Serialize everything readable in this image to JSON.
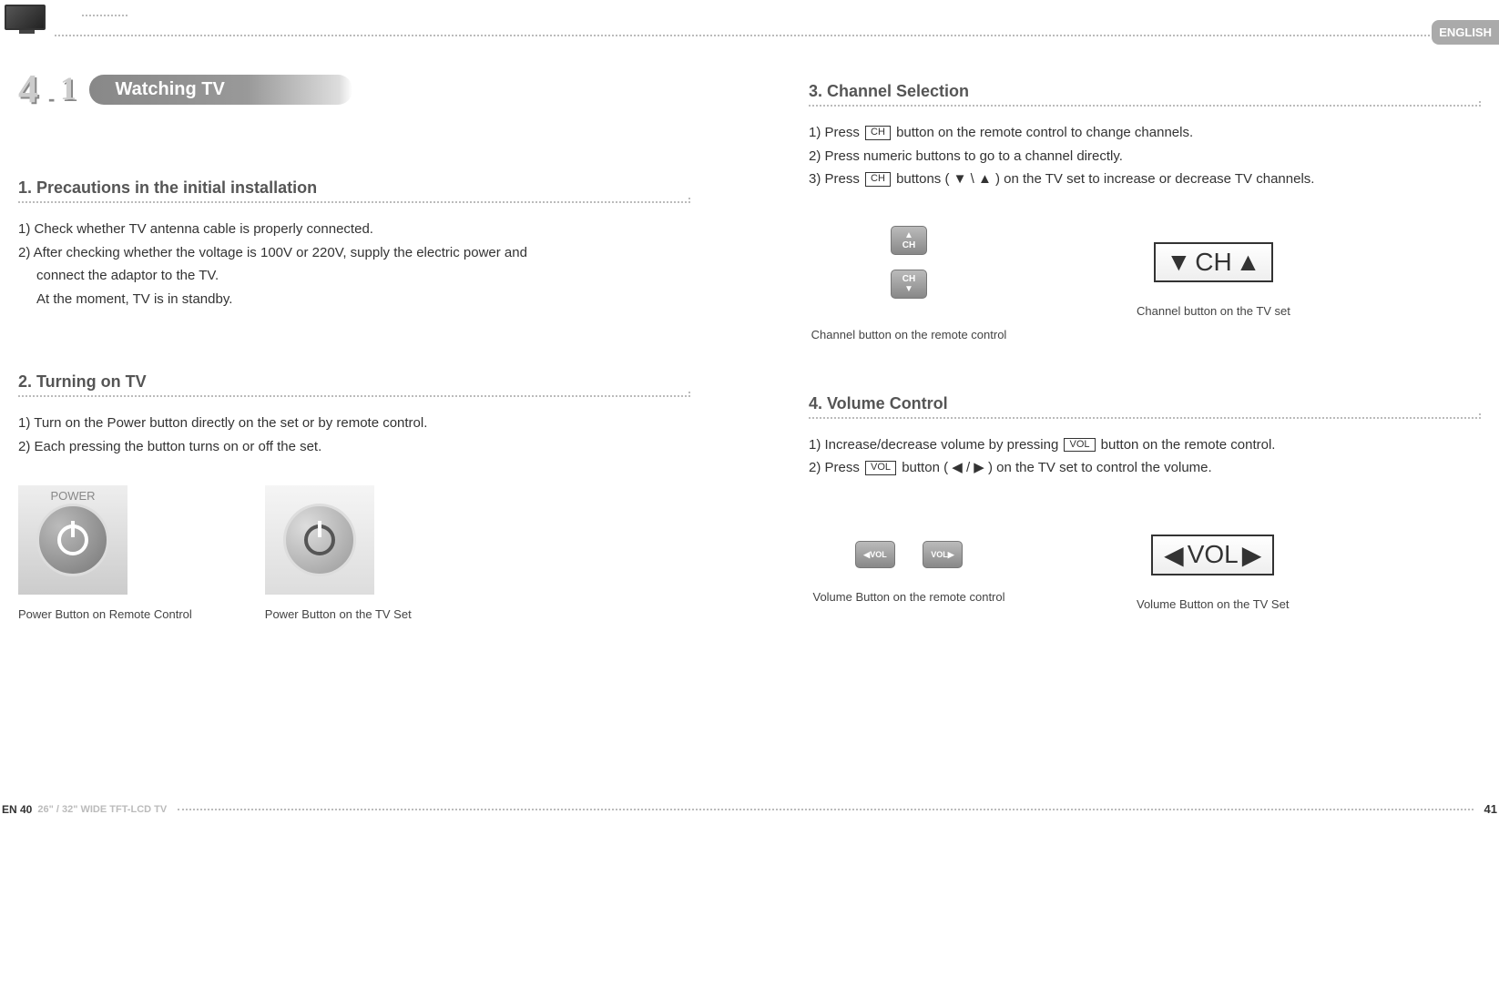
{
  "header": {
    "language_tab": "ENGLISH",
    "section_number_main": "4",
    "section_number_sub": "1",
    "dash": "-",
    "title": "Watching TV"
  },
  "sec1": {
    "heading": "1. Precautions in the initial installation",
    "p1": "1) Check whether TV antenna cable is properly connected.",
    "p2a": "2) After checking whether the voltage is 100V or 220V, supply the electric power and",
    "p2b": "connect the adaptor to the TV.",
    "p2c": "At the moment, TV is in standby."
  },
  "sec2": {
    "heading": "2. Turning on TV",
    "p1": "1) Turn on the Power button directly on the set or by remote control.",
    "p2": "2) Each pressing the button turns on or off the set.",
    "power_label": "POWER",
    "cap1": "Power Button on Remote Control",
    "cap2": "Power Button on the TV Set"
  },
  "sec3": {
    "heading": "3. Channel Selection",
    "p1a": "1) Press ",
    "btn_ch": "CH",
    "p1b": " button on the remote control to change channels.",
    "p2": "2) Press numeric buttons to go to a channel directly.",
    "p3a": "3) Press ",
    "p3b": " buttons ( ▼ \\ ▲ ) on the TV set to increase or decrease TV channels.",
    "remote_ch_label": "CH",
    "tvset_ch_label": "CH",
    "cap1": "Channel button on the remote control",
    "cap2": "Channel button on the TV set"
  },
  "sec4": {
    "heading": "4. Volume Control",
    "p1a": "1) Increase/decrease volume by pressing ",
    "btn_vol": "VOL",
    "p1b": " button on the remote control.",
    "p2a": "2) Press ",
    "p2b": " button ( ◀ / ▶ ) on the TV set to control the volume.",
    "remote_vol_label": "VOL",
    "tvset_vol_label": "VOL",
    "cap1": "Volume Button on the remote control",
    "cap2": "Volume Button on the TV Set"
  },
  "footer": {
    "page_left": "EN 40",
    "model": "26\" / 32\" WIDE TFT-LCD TV",
    "page_right": "41"
  }
}
